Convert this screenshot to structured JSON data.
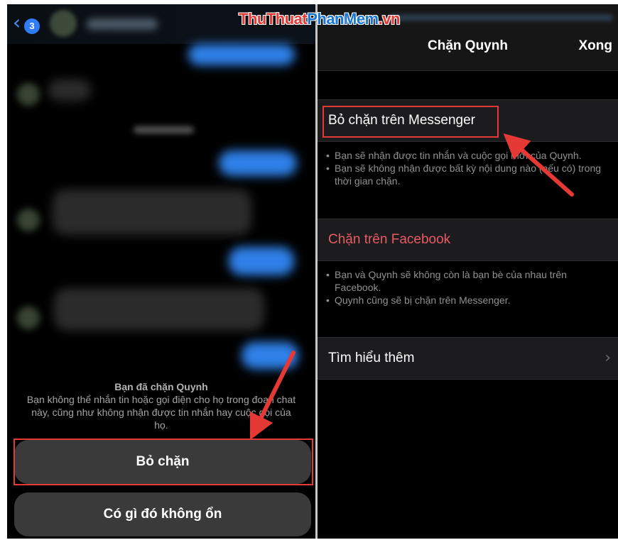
{
  "watermark": {
    "part1": "ThuThuat",
    "part2": "PhanMem",
    "part3": ".vn"
  },
  "left": {
    "back_badge": "3",
    "blocked_title": "Bạn đã chặn Quynh",
    "blocked_desc": "Bạn không thể nhắn tin hoặc gọi điện cho họ trong đoạn chat này, cũng như không nhận được tin nhắn hay cuộc gọi của họ.",
    "unblock_button": "Bỏ chặn",
    "problem_button": "Có gì đó không ổn"
  },
  "right": {
    "title": "Chặn Quynh",
    "done": "Xong",
    "unblock_messenger": "Bỏ chặn trên Messenger",
    "unblock_desc": [
      "Bạn sẽ nhận được tin nhắn và cuộc gọi mới của Quynh.",
      "Bạn sẽ không nhận được bất kỳ nội dung nào (nếu có) trong thời gian chặn."
    ],
    "block_facebook": "Chặn trên Facebook",
    "block_fb_desc": [
      "Bạn và Quynh sẽ không còn là bạn bè của nhau trên Facebook.",
      "Quynh cũng sẽ bị chặn trên Messenger."
    ],
    "learn_more": "Tìm hiểu thêm"
  },
  "icons": {
    "back": "chevron-left-icon",
    "chevron": "chevron-right-icon",
    "arrow": "red-arrow"
  },
  "colors": {
    "accent_blue": "#2f7cf6",
    "red_text": "#e85a64",
    "highlight": "#e53935",
    "bubble_blue": "#2e80e8"
  }
}
